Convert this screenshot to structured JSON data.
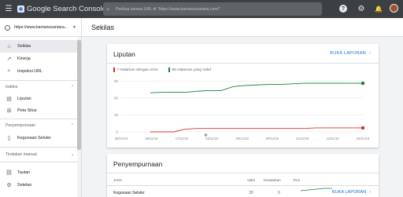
{
  "topbar": {
    "app_name": "Google Search Console",
    "search_placeholder": "Periksa semua URL di \"https://www.kamanusantara.com/\""
  },
  "property": {
    "url": "https://www.kamanusantara..."
  },
  "page_title": "Sekilas",
  "sidebar": {
    "items": [
      {
        "label": "Sekilas",
        "icon": "home-icon",
        "active": true
      },
      {
        "label": "Kinerja",
        "icon": "trend-icon"
      },
      {
        "label": "Inspeksi URL",
        "icon": "search-icon"
      }
    ],
    "section_index": "Indeks",
    "index_items": [
      {
        "label": "Liputan",
        "icon": "coverage-icon"
      },
      {
        "label": "Peta Situs",
        "icon": "sitemap-icon"
      }
    ],
    "section_enhancements": "Penyempurnaan",
    "enhancement_items": [
      {
        "label": "Kegunaan Seluler",
        "icon": "mobile-icon"
      }
    ],
    "section_manual": "Tindakan manual",
    "bottom_items": [
      {
        "label": "Tautan",
        "icon": "link-icon"
      },
      {
        "label": "Setelan",
        "icon": "gear-icon"
      }
    ]
  },
  "coverage_card": {
    "title": "Liputan",
    "link": "BUKA LAPORAN",
    "legend_error": "7 Halaman dengan error",
    "legend_valid": "86 Halaman yang Valid",
    "colors": {
      "error": "#d93025",
      "valid": "#188038"
    }
  },
  "chart_data": {
    "type": "line",
    "x": [
      "26/10/18",
      "05/11/18",
      "17/11/18",
      "28/11/18",
      "09/12/18",
      "20/12/18",
      "31/12/18",
      "11/01/19",
      "22/01/19"
    ],
    "ylim": [
      0,
      100
    ],
    "yticks": [
      0,
      30,
      60,
      90
    ],
    "series": [
      {
        "name": "86 Halaman yang Valid",
        "values": [
          69,
          70,
          70,
          70,
          72,
          73,
          73,
          80,
          82,
          83,
          84,
          84,
          85,
          86,
          86,
          86,
          86,
          86,
          86
        ]
      },
      {
        "name": "7 Halaman dengan error",
        "values": [
          0,
          0,
          0,
          5,
          6,
          6,
          6,
          6,
          6,
          6,
          6,
          6,
          6,
          6,
          7,
          7,
          7,
          7,
          7
        ]
      }
    ]
  },
  "enhancement_card": {
    "title": "Penyempurnaan",
    "columns": [
      "Jenis",
      "Valid",
      "Kesalahan",
      "Tren"
    ],
    "row": {
      "type": "Kegunaan Seluler",
      "valid": "29",
      "errors": "0"
    },
    "link": "BUKA LAPORAN"
  }
}
